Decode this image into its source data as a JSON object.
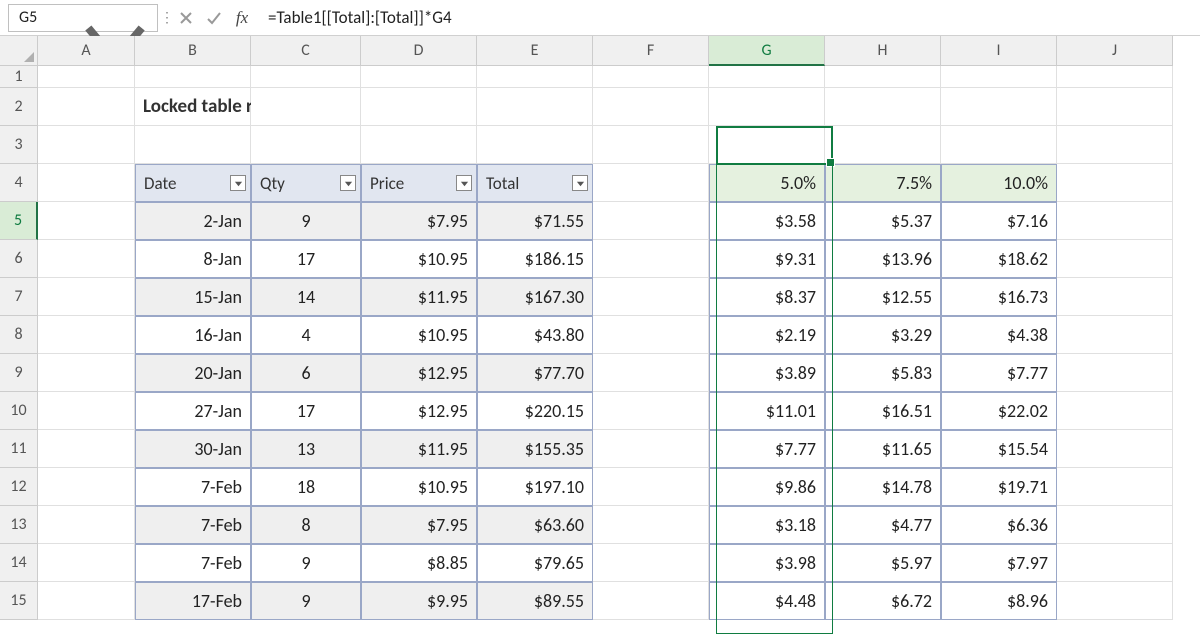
{
  "name_box": "G5",
  "formula": "=Table1[[Total]:[Total]]*G4",
  "columns": [
    "A",
    "B",
    "C",
    "D",
    "E",
    "F",
    "G",
    "H",
    "I",
    "J"
  ],
  "rows": [
    "1",
    "2",
    "3",
    "4",
    "5",
    "6",
    "7",
    "8",
    "9",
    "10",
    "11",
    "12",
    "13",
    "14",
    "15"
  ],
  "active_col": "G",
  "active_row": "5",
  "title": "Locked table reference",
  "table_headers": [
    "Date",
    "Qty",
    "Price",
    "Total"
  ],
  "table_rows": [
    {
      "date": "2-Jan",
      "qty": "9",
      "price": "$7.95",
      "total": "$71.55"
    },
    {
      "date": "8-Jan",
      "qty": "17",
      "price": "$10.95",
      "total": "$186.15"
    },
    {
      "date": "15-Jan",
      "qty": "14",
      "price": "$11.95",
      "total": "$167.30"
    },
    {
      "date": "16-Jan",
      "qty": "4",
      "price": "$10.95",
      "total": "$43.80"
    },
    {
      "date": "20-Jan",
      "qty": "6",
      "price": "$12.95",
      "total": "$77.70"
    },
    {
      "date": "27-Jan",
      "qty": "17",
      "price": "$12.95",
      "total": "$220.15"
    },
    {
      "date": "30-Jan",
      "qty": "13",
      "price": "$11.95",
      "total": "$155.35"
    },
    {
      "date": "7-Feb",
      "qty": "18",
      "price": "$10.95",
      "total": "$197.10"
    },
    {
      "date": "7-Feb",
      "qty": "8",
      "price": "$7.95",
      "total": "$63.60"
    },
    {
      "date": "7-Feb",
      "qty": "9",
      "price": "$8.85",
      "total": "$79.65"
    },
    {
      "date": "17-Feb",
      "qty": "9",
      "price": "$9.95",
      "total": "$89.55"
    }
  ],
  "percents": [
    "5.0%",
    "7.5%",
    "10.0%"
  ],
  "results": [
    [
      "$3.58",
      "$5.37",
      "$7.16"
    ],
    [
      "$9.31",
      "$13.96",
      "$18.62"
    ],
    [
      "$8.37",
      "$12.55",
      "$16.73"
    ],
    [
      "$2.19",
      "$3.29",
      "$4.38"
    ],
    [
      "$3.89",
      "$5.83",
      "$7.77"
    ],
    [
      "$11.01",
      "$16.51",
      "$22.02"
    ],
    [
      "$7.77",
      "$11.65",
      "$15.54"
    ],
    [
      "$9.86",
      "$14.78",
      "$19.71"
    ],
    [
      "$3.18",
      "$4.77",
      "$6.36"
    ],
    [
      "$3.98",
      "$5.97",
      "$7.97"
    ],
    [
      "$4.48",
      "$6.72",
      "$8.96"
    ]
  ],
  "chart_data": {
    "type": "table",
    "title": "Locked table reference",
    "source_columns": [
      "Date",
      "Qty",
      "Price",
      "Total"
    ],
    "source_rows": [
      [
        "2-Jan",
        9,
        7.95,
        71.55
      ],
      [
        "8-Jan",
        17,
        10.95,
        186.15
      ],
      [
        "15-Jan",
        14,
        11.95,
        167.3
      ],
      [
        "16-Jan",
        4,
        10.95,
        43.8
      ],
      [
        "20-Jan",
        6,
        12.95,
        77.7
      ],
      [
        "27-Jan",
        17,
        12.95,
        220.15
      ],
      [
        "30-Jan",
        13,
        11.95,
        155.35
      ],
      [
        "7-Feb",
        18,
        10.95,
        197.1
      ],
      [
        "7-Feb",
        8,
        7.95,
        63.6
      ],
      [
        "7-Feb",
        9,
        8.85,
        79.65
      ],
      [
        "17-Feb",
        9,
        9.95,
        89.55
      ]
    ],
    "multipliers": [
      0.05,
      0.075,
      0.1
    ],
    "results": [
      [
        3.58,
        5.37,
        7.16
      ],
      [
        9.31,
        13.96,
        18.62
      ],
      [
        8.37,
        12.55,
        16.73
      ],
      [
        2.19,
        3.29,
        4.38
      ],
      [
        3.89,
        5.83,
        7.77
      ],
      [
        11.01,
        16.51,
        22.02
      ],
      [
        7.77,
        11.65,
        15.54
      ],
      [
        9.86,
        14.78,
        19.71
      ],
      [
        3.18,
        4.77,
        6.36
      ],
      [
        3.98,
        5.97,
        7.97
      ],
      [
        4.48,
        6.72,
        8.96
      ]
    ],
    "formula": "=Table1[[Total]:[Total]]*G4"
  }
}
